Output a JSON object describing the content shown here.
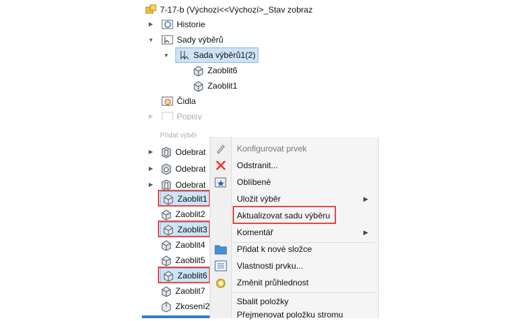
{
  "top_tree": {
    "root_label": "7-17-b  (Výchozí<<Výchozí>_Stav zobraz",
    "items": [
      {
        "label": "Historie"
      },
      {
        "label": "Sady výběrů"
      },
      {
        "label": "Sada výběrů1(2)"
      },
      {
        "label": "Zaoblit6"
      },
      {
        "label": "Zaoblit1"
      },
      {
        "label": "Čidla"
      },
      {
        "label": "Popisy"
      }
    ]
  },
  "bottom_tree": {
    "items": [
      {
        "label": "Přidat výběr"
      },
      {
        "label": "Odebrat"
      },
      {
        "label": "Odebrat"
      },
      {
        "label": "Odebrat"
      },
      {
        "label": "Zaoblit1"
      },
      {
        "label": "Zaoblit2"
      },
      {
        "label": "Zaoblit3"
      },
      {
        "label": "Zaoblit4"
      },
      {
        "label": "Zaoblit5"
      },
      {
        "label": "Zaoblit6"
      },
      {
        "label": "Zaoblit7"
      },
      {
        "label": "Zkosení2"
      }
    ]
  },
  "context_menu": {
    "items": [
      {
        "label": "Konfigurovat prvek",
        "icon": "pencil-icon"
      },
      {
        "label": "Odstranit...",
        "icon": "delete-x-icon"
      },
      {
        "label": "Oblíbené",
        "icon": "favorites-icon"
      },
      {
        "label": "Uložit výběr",
        "icon": "",
        "submenu": "▶"
      },
      {
        "label": "Aktualizovat sadu výběru",
        "icon": ""
      },
      {
        "label": "Komentář",
        "icon": "",
        "submenu": "▶"
      },
      {
        "label": "Přidat k nové složce",
        "icon": "folder-icon"
      },
      {
        "label": "Vlastnosti prvku...",
        "icon": "properties-icon"
      },
      {
        "label": "Změnit průhlednost",
        "icon": "transparency-icon"
      },
      {
        "label": "Sbalit položky",
        "icon": ""
      },
      {
        "label": "Přejmenovat položku stromu",
        "icon": ""
      }
    ]
  },
  "colors": {
    "highlight_red": "#e04a4a",
    "selection_blue": "#cde4f7"
  }
}
